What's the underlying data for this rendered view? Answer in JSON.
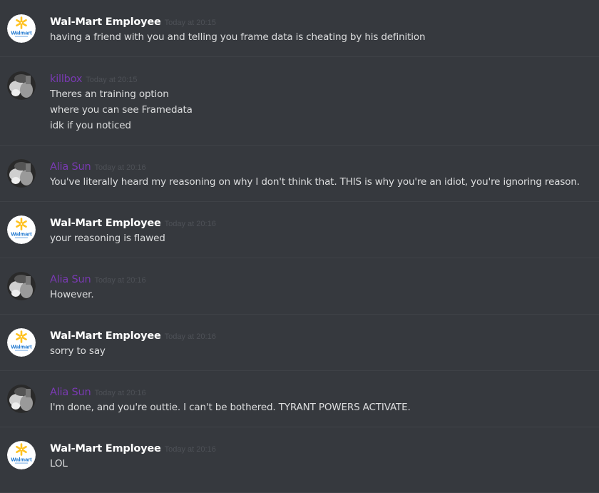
{
  "messages": [
    {
      "author": "Wal-Mart Employee",
      "author_style": "white",
      "avatar": "walmart-logo-avatar",
      "timestamp": "Today at 20:15",
      "lines": [
        "having a friend with you and telling you frame data is cheating by his definition"
      ]
    },
    {
      "author": "killbox",
      "author_style": "purple",
      "avatar": "photo-avatar",
      "timestamp": "Today at 20:15",
      "lines": [
        "Theres an training option",
        "where you can see Framedata",
        "idk if you noticed"
      ]
    },
    {
      "author": "Alia Sun",
      "author_style": "purple",
      "avatar": "photo-avatar",
      "timestamp": "Today at 20:16",
      "lines": [
        "You've literally heard my reasoning on why I don't think that. THIS is why you're an idiot, you're ignoring reason."
      ]
    },
    {
      "author": "Wal-Mart Employee",
      "author_style": "white",
      "avatar": "walmart-logo-avatar",
      "timestamp": "Today at 20:16",
      "lines": [
        "your reasoning is flawed"
      ]
    },
    {
      "author": "Alia Sun",
      "author_style": "purple",
      "avatar": "photo-avatar",
      "timestamp": "Today at 20:16",
      "lines": [
        "However."
      ]
    },
    {
      "author": "Wal-Mart Employee",
      "author_style": "white",
      "avatar": "walmart-logo-avatar",
      "timestamp": "Today at 20:16",
      "lines": [
        "sorry to say"
      ]
    },
    {
      "author": "Alia Sun",
      "author_style": "purple",
      "avatar": "photo-avatar",
      "timestamp": "Today at 20:16",
      "lines": [
        "I'm done, and you're outtie. I can't be bothered. TYRANT POWERS ACTIVATE."
      ]
    },
    {
      "author": "Wal-Mart Employee",
      "author_style": "white",
      "avatar": "walmart-logo-avatar",
      "timestamp": "Today at 20:16",
      "lines": [
        "LOL"
      ]
    }
  ],
  "walmart_logo_text": "Walmart",
  "colors": {
    "background": "#36393e",
    "username_white": "#ffffff",
    "username_purple": "#7a3ab3",
    "timestamp": "#4e5157",
    "message_text": "#dcddde",
    "divider": "#3f4247",
    "walmart_blue": "#1a75cf",
    "walmart_yellow": "#ffc220"
  }
}
